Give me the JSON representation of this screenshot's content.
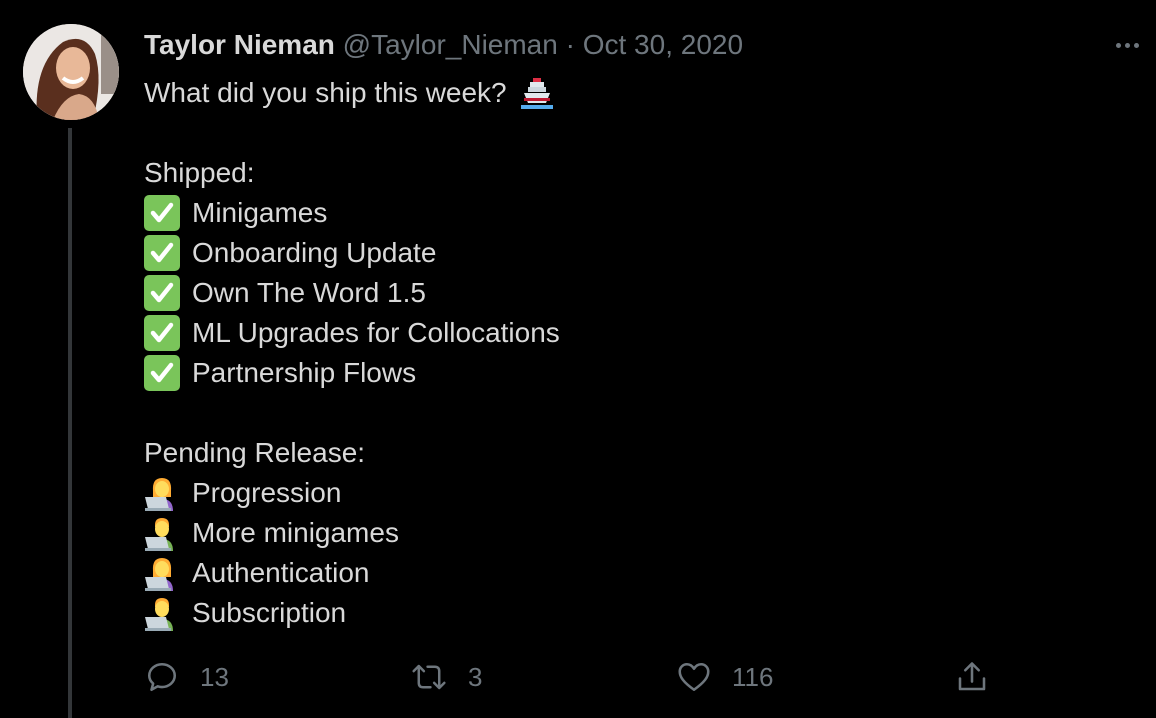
{
  "tweet": {
    "author_name": "Taylor Nieman",
    "handle": "@Taylor_Nieman",
    "separator": "·",
    "date": "Oct 30, 2020",
    "intro": "What did you ship this week?",
    "intro_icon": "ship-emoji",
    "shipped_heading": "Shipped:",
    "shipped_items": [
      {
        "icon": "check-mark-button-emoji",
        "label": "Minigames"
      },
      {
        "icon": "check-mark-button-emoji",
        "label": "Onboarding Update"
      },
      {
        "icon": "check-mark-button-emoji",
        "label": "Own The Word 1.5"
      },
      {
        "icon": "check-mark-button-emoji",
        "label": "ML Upgrades for Collocations"
      },
      {
        "icon": "check-mark-button-emoji",
        "label": "Partnership Flows"
      }
    ],
    "pending_heading": "Pending Release:",
    "pending_items": [
      {
        "icon": "woman-technologist-emoji",
        "label": "Progression"
      },
      {
        "icon": "man-technologist-emoji",
        "label": "More minigames"
      },
      {
        "icon": "woman-technologist-emoji",
        "label": "Authentication"
      },
      {
        "icon": "man-technologist-emoji",
        "label": "Subscription"
      }
    ]
  },
  "actions": {
    "reply_count": "13",
    "retweet_count": "3",
    "like_count": "116"
  },
  "colors": {
    "background": "#000000",
    "text": "#d9d9d9",
    "muted": "#6e767d",
    "thread_line": "#333639",
    "check_green": "#7ac55a"
  }
}
